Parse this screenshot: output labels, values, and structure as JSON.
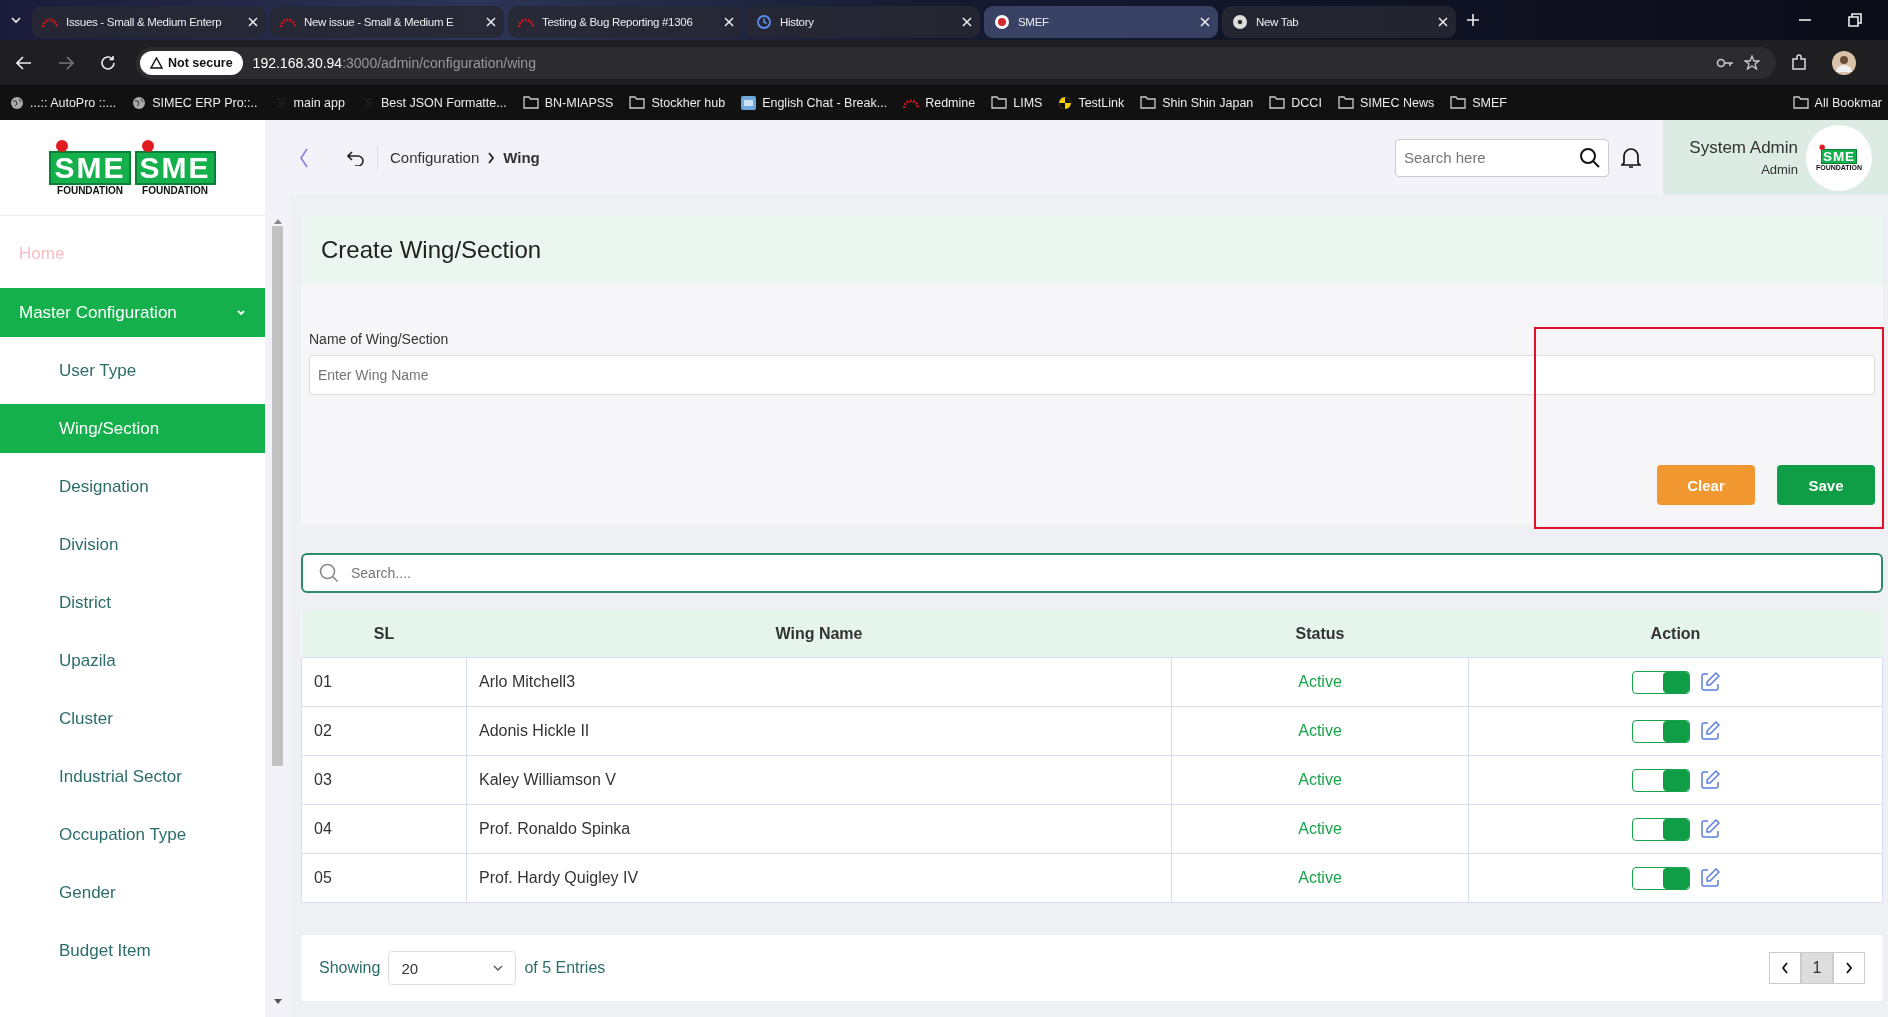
{
  "browser": {
    "tabs": [
      {
        "title": "Issues - Small & Medium Enterp",
        "kind": "redmine",
        "selected": false
      },
      {
        "title": "New issue - Small & Medium E",
        "kind": "redmine",
        "selected": false
      },
      {
        "title": "Testing & Bug Reporting #1306",
        "kind": "redmine",
        "selected": false
      },
      {
        "title": "History",
        "kind": "history",
        "selected": false
      },
      {
        "title": "SMEF",
        "kind": "smef",
        "selected": true
      },
      {
        "title": "New Tab",
        "kind": "chrome",
        "selected": false
      }
    ],
    "security": "Not secure",
    "url_host": "192.168.30.94",
    "url_path": ":3000/admin/configuration/wing",
    "bookmarks": [
      {
        "label": "...:: AutoPro ::...",
        "kind": "globe"
      },
      {
        "label": "SIMEC ERP Pro::..",
        "kind": "globe"
      },
      {
        "label": "main app",
        "kind": "jf"
      },
      {
        "label": "Best JSON Formatte...",
        "kind": "jf"
      },
      {
        "label": "BN-MIAPSS",
        "kind": "folder"
      },
      {
        "label": "Stockher hub",
        "kind": "folder"
      },
      {
        "label": "English Chat - Break...",
        "kind": "bd"
      },
      {
        "label": "Redmine",
        "kind": "redmine"
      },
      {
        "label": "LIMS",
        "kind": "folder"
      },
      {
        "label": "TestLink",
        "kind": "testlink"
      },
      {
        "label": "Shin Shin Japan",
        "kind": "folder"
      },
      {
        "label": "DCCI",
        "kind": "folder"
      },
      {
        "label": "SIMEC News",
        "kind": "folder"
      },
      {
        "label": "SMEF",
        "kind": "folder"
      }
    ],
    "all_bookmarks": "All Bookmar"
  },
  "sidebar": {
    "logos": [
      {
        "mark": "SME",
        "caption": "FOUNDATION"
      },
      {
        "mark": "SME",
        "caption": "FOUNDATION"
      }
    ],
    "home": {
      "label": "Home",
      "disabled": true
    },
    "group": {
      "label": "Master Configuration",
      "expanded": true,
      "items": [
        {
          "label": "User Type",
          "selected": false
        },
        {
          "label": "Wing/Section",
          "selected": true
        },
        {
          "label": "Designation",
          "selected": false
        },
        {
          "label": "Division",
          "selected": false
        },
        {
          "label": "District",
          "selected": false
        },
        {
          "label": "Upazila",
          "selected": false
        },
        {
          "label": "Cluster",
          "selected": false
        },
        {
          "label": "Industrial Sector",
          "selected": false
        },
        {
          "label": "Occupation Type",
          "selected": false
        },
        {
          "label": "Gender",
          "selected": false
        },
        {
          "label": "Budget Item",
          "selected": false
        }
      ]
    }
  },
  "header": {
    "breadcrumb": [
      {
        "label": "Configuration",
        "current": false
      },
      {
        "label": "Wing",
        "current": true
      }
    ],
    "search": {
      "placeholder": "Search here"
    },
    "user": {
      "name": "System Admin",
      "role": "Admin",
      "logo": {
        "mark": "SME",
        "caption": "FOUNDATION"
      }
    }
  },
  "form": {
    "title": "Create Wing/Section",
    "field_label": "Name of Wing/Section",
    "placeholder": "Enter Wing Name",
    "buttons": [
      {
        "label": "Clear",
        "kind": "clear"
      },
      {
        "label": "Save",
        "kind": "save"
      }
    ]
  },
  "annotations": [
    {
      "kind": "box"
    }
  ],
  "table": {
    "search": {
      "placeholder": "Search...."
    },
    "columns": [
      "SL",
      "Wing Name",
      "Status",
      "Action"
    ],
    "rows": [
      {
        "sl": "01",
        "name": "Arlo Mitchell3",
        "status": "Active",
        "active": true
      },
      {
        "sl": "02",
        "name": "Adonis Hickle II",
        "status": "Active",
        "active": true
      },
      {
        "sl": "03",
        "name": "Kaley Williamson V",
        "status": "Active",
        "active": true
      },
      {
        "sl": "04",
        "name": "Prof. Ronaldo Spinka",
        "status": "Active",
        "active": true
      },
      {
        "sl": "05",
        "name": "Prof. Hardy Quigley IV",
        "status": "Active",
        "active": true
      }
    ]
  },
  "pagination": {
    "showing": "Showing",
    "page_size": "20",
    "entries": "of 5 Entries",
    "pages": [
      {
        "label": "1",
        "selected": true
      }
    ]
  }
}
